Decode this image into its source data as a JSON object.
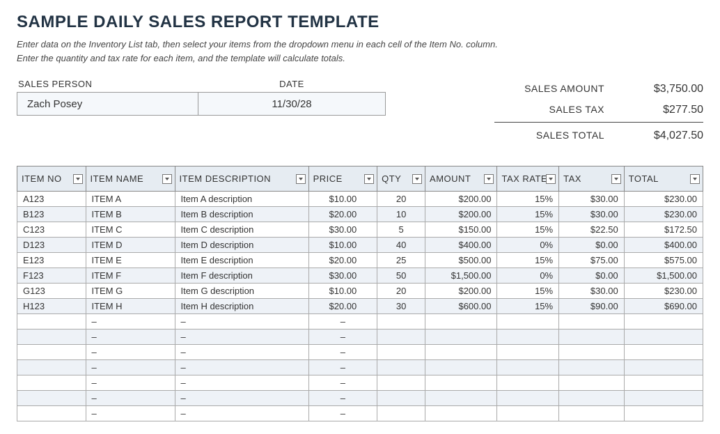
{
  "title": "SAMPLE DAILY SALES REPORT TEMPLATE",
  "instructions_line1": "Enter data on the Inventory List tab, then select your items from the dropdown menu in each cell of the Item No. column.",
  "instructions_line2": "Enter the quantity and tax rate for each item, and the template will calculate totals.",
  "labels": {
    "sales_person": "SALES PERSON",
    "date": "DATE",
    "sales_amount": "SALES AMOUNT",
    "sales_tax": "SALES TAX",
    "sales_total": "SALES TOTAL"
  },
  "sales_person": "Zach Posey",
  "date": "11/30/28",
  "summary": {
    "sales_amount": "$3,750.00",
    "sales_tax": "$277.50",
    "sales_total": "$4,027.50"
  },
  "columns": {
    "item_no": "ITEM NO",
    "item_name": "ITEM NAME",
    "item_desc": "ITEM DESCRIPTION",
    "price": "PRICE",
    "qty": "QTY",
    "amount": "AMOUNT",
    "tax_rate": "TAX RATE",
    "tax": "TAX",
    "total": "TOTAL"
  },
  "rows": [
    {
      "no": "A123",
      "name": "ITEM A",
      "desc": "Item A description",
      "price": "$10.00",
      "qty": "20",
      "amount": "$200.00",
      "rate": "15%",
      "tax": "$30.00",
      "total": "$230.00"
    },
    {
      "no": "B123",
      "name": "ITEM B",
      "desc": "Item B description",
      "price": "$20.00",
      "qty": "10",
      "amount": "$200.00",
      "rate": "15%",
      "tax": "$30.00",
      "total": "$230.00"
    },
    {
      "no": "C123",
      "name": "ITEM C",
      "desc": "Item C description",
      "price": "$30.00",
      "qty": "5",
      "amount": "$150.00",
      "rate": "15%",
      "tax": "$22.50",
      "total": "$172.50"
    },
    {
      "no": "D123",
      "name": "ITEM D",
      "desc": "Item D description",
      "price": "$10.00",
      "qty": "40",
      "amount": "$400.00",
      "rate": "0%",
      "tax": "$0.00",
      "total": "$400.00"
    },
    {
      "no": "E123",
      "name": "ITEM E",
      "desc": "Item E description",
      "price": "$20.00",
      "qty": "25",
      "amount": "$500.00",
      "rate": "15%",
      "tax": "$75.00",
      "total": "$575.00"
    },
    {
      "no": "F123",
      "name": "ITEM F",
      "desc": "Item F description",
      "price": "$30.00",
      "qty": "50",
      "amount": "$1,500.00",
      "rate": "0%",
      "tax": "$0.00",
      "total": "$1,500.00"
    },
    {
      "no": "G123",
      "name": "ITEM G",
      "desc": "Item G description",
      "price": "$10.00",
      "qty": "20",
      "amount": "$200.00",
      "rate": "15%",
      "tax": "$30.00",
      "total": "$230.00"
    },
    {
      "no": "H123",
      "name": "ITEM H",
      "desc": "Item H description",
      "price": "$20.00",
      "qty": "30",
      "amount": "$600.00",
      "rate": "15%",
      "tax": "$90.00",
      "total": "$690.00"
    }
  ],
  "empty_dash": "–",
  "empty_row_count": 7
}
